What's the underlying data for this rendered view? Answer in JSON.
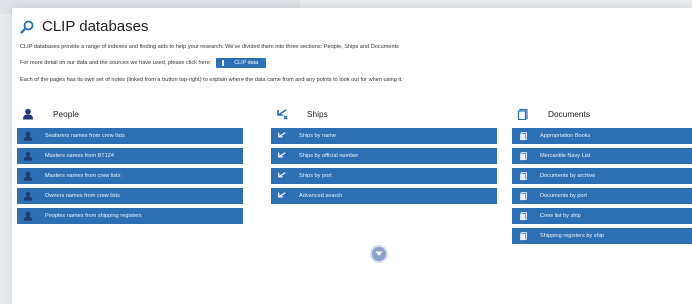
{
  "title": "CLIP databases",
  "intro": {
    "line1": "CLIP databases provide a range of indexes and finding aids to help your research. We've divided them into three sections: People, Ships and Documents",
    "line2": "For more detail on our data and the sources we have used, please click here:",
    "clip_button": "CLIP data",
    "line3": "Each of the pages has its own set of notes (linked from a button top-right) to explain where the data came from and any points to look out for when using it."
  },
  "columns": {
    "people": {
      "heading": "People",
      "icon": "person-icon",
      "items": [
        "Seafarers names from crew lists",
        "Masters names from BT124",
        "Masters names from crew lists",
        "Owners names from crew lists",
        "Peoples names from shipping registers"
      ]
    },
    "ships": {
      "heading": "Ships",
      "icon": "ship-icon",
      "items": [
        "Ships by name",
        "Ships by official number",
        "Ships by port",
        "Advanced search"
      ]
    },
    "documents": {
      "heading": "Documents",
      "icon": "document-icon",
      "items": [
        "Appropriation Books",
        "Mercantile Navy List",
        "Documents by archive",
        "Documents by port",
        "Crew list by ship",
        "Shipping registers by ship"
      ]
    }
  },
  "colors": {
    "accent": "#2c6fb2",
    "item_text": "#eef4fb",
    "scroll_icon": "#8c9fc8"
  },
  "scroll_icon": "chevron-down-circle-icon"
}
